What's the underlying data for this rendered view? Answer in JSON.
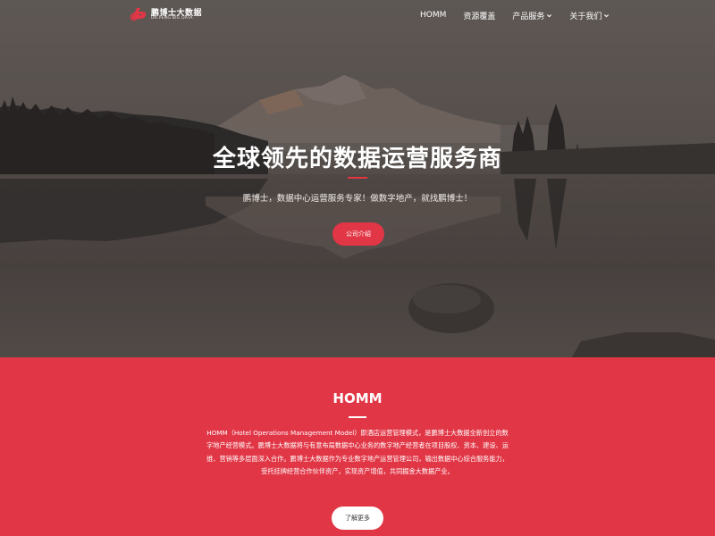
{
  "brand": {
    "name_cn": "鹏博士大数据",
    "name_en": "DR.PENG BIG DATA",
    "accent": "#e13645"
  },
  "nav": {
    "items": [
      {
        "label": "HOMM",
        "has_dropdown": false
      },
      {
        "label": "资源覆盖",
        "has_dropdown": false
      },
      {
        "label": "产品服务",
        "has_dropdown": true,
        "icon": "chevron-down-icon"
      },
      {
        "label": "关于我们",
        "has_dropdown": true,
        "icon": "chevron-down-icon"
      }
    ]
  },
  "hero": {
    "title": "全球领先的数据运营服务商",
    "subtitle": "鹏博士，数据中心运营服务专家！做数字地产，就找鹏博士！",
    "button_label": "公司介绍"
  },
  "homm": {
    "title": "HOMM",
    "paragraph": "HOMM（Hotel Operations Management Model）即酒店运营管理模式，是鹏博士大数据全新创立的数字地产经营模式。鹏博士大数据将与有意布局数据中心业务的数字地产经营者在项目股权、资本、建设、运维、营销等多层面深入合作。鹏博士大数据作为专业数字地产运营管理公司，输出数据中心综合服务能力，受托挂牌经营合作伙伴资产，实现资产增值，共同掘金大数据产业。",
    "button_label": "了解更多"
  }
}
